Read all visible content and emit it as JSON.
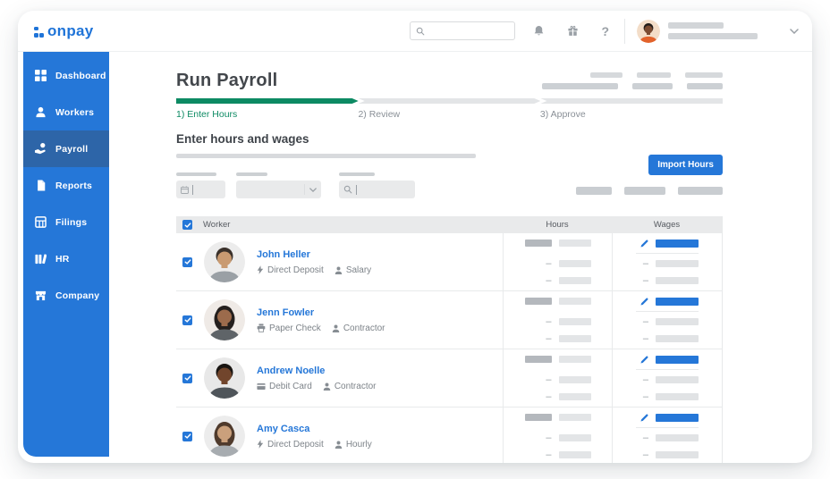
{
  "topbar": {
    "logo_text": "onpay",
    "search": {
      "value": "",
      "placeholder": ""
    },
    "icons": [
      "search-icon",
      "bell-icon",
      "gift-icon",
      "help-icon",
      "chevron-down-icon"
    ],
    "user": {
      "avatar_colors": {
        "bg": "#f3ddc8",
        "skin": "#7b4a30",
        "hair": "#221c18",
        "shirt": "#e2622b",
        "long": false
      }
    }
  },
  "sidebar": {
    "items": [
      {
        "label": "Dashboard",
        "icon": "dashboard-grid",
        "active": false
      },
      {
        "label": "Workers",
        "icon": "workers-person",
        "active": false
      },
      {
        "label": "Payroll",
        "icon": "payroll-hand",
        "active": true
      },
      {
        "label": "Reports",
        "icon": "reports-doc",
        "active": false
      },
      {
        "label": "Filings",
        "icon": "filings-table",
        "active": false
      },
      {
        "label": "HR",
        "icon": "hr-books",
        "active": false
      },
      {
        "label": "Company",
        "icon": "company-store",
        "active": false
      }
    ]
  },
  "main": {
    "page_title": "Run Payroll",
    "progress": {
      "percent_complete": 33,
      "steps": [
        {
          "label": "1) Enter Hours",
          "state": "active"
        },
        {
          "label": "2) Review",
          "state": "upcoming"
        },
        {
          "label": "3) Approve",
          "state": "upcoming"
        }
      ]
    },
    "section_title": "Enter hours and wages",
    "import_button_label": "Import Hours",
    "table": {
      "select_all_checked": true,
      "columns": [
        "Worker",
        "Hours",
        "Wages"
      ],
      "rows": [
        {
          "name": "John Heller",
          "payment_icon": "lightning",
          "payment_method": "Direct Deposit",
          "worker_type": "Salary",
          "checked": true,
          "avatar_colors": {
            "bg": "#ececec",
            "skin": "#c99a71",
            "hair": "#3a312b",
            "shirt": "#9aa0a5",
            "long": false
          }
        },
        {
          "name": "Jenn Fowler",
          "payment_icon": "printer",
          "payment_method": "Paper Check",
          "worker_type": "Contractor",
          "checked": true,
          "avatar_colors": {
            "bg": "#efeae6",
            "skin": "#9c6b4c",
            "hair": "#241f1d",
            "shirt": "#5f6468",
            "long": true
          }
        },
        {
          "name": "Andrew Noelle",
          "payment_icon": "card",
          "payment_method": "Debit Card",
          "worker_type": "Contractor",
          "checked": true,
          "avatar_colors": {
            "bg": "#e8e8e8",
            "skin": "#71452c",
            "hair": "#191512",
            "shirt": "#4f555a",
            "long": false
          }
        },
        {
          "name": "Amy Casca",
          "payment_icon": "lightning",
          "payment_method": "Direct Deposit",
          "worker_type": "Hourly",
          "checked": true,
          "avatar_colors": {
            "bg": "#ececec",
            "skin": "#caa07c",
            "hair": "#4f3a2c",
            "shirt": "#a7acb0",
            "long": true
          }
        }
      ]
    }
  },
  "ui": {
    "dash": "–",
    "help_glyph": "?"
  },
  "colors": {
    "brand_blue": "#2577d8",
    "sidebar_active_blue": "#2d65a8",
    "progress_green": "#0d8a63",
    "link_blue": "#2577d8",
    "muted_gray": "#8a9097",
    "placeholder_gray": "#ccd0d4",
    "table_header_bg": "#e9eaeb"
  }
}
